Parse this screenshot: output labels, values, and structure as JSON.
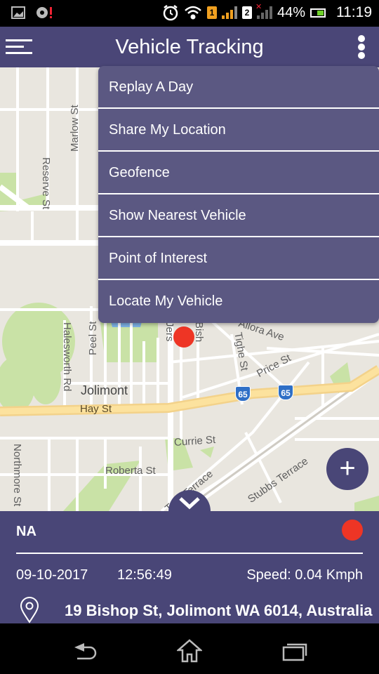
{
  "status_bar": {
    "battery_percent": "44%",
    "time": "11:19",
    "sim1_label": "1",
    "sim2_label": "2",
    "sim1_color": "#f0a020",
    "sim2_color": "#ffffff"
  },
  "app_bar": {
    "title": "Vehicle Tracking",
    "color": "#4a4677"
  },
  "menu": {
    "items": [
      {
        "label": "Replay A Day"
      },
      {
        "label": "Share My Location"
      },
      {
        "label": "Geofence"
      },
      {
        "label": "Show Nearest Vehicle"
      },
      {
        "label": "Point of Interest"
      },
      {
        "label": "Locate My Vehicle"
      }
    ]
  },
  "map": {
    "streets": {
      "reserve": "Reserve St",
      "marlow": "Marlow St",
      "halesworth": "Halesworth Rd",
      "peel": "Peel St",
      "jersey": "Jers",
      "bishop": "Bish",
      "allora": "Allora Ave",
      "tighe": "Tighe St",
      "price": "Price St",
      "hay": "Hay St",
      "currie": "Currie St",
      "roberta": "Roberta St",
      "troy": "Troy Terrace",
      "stubbs": "Stubbs Terrace",
      "northmore": "Northmore St"
    },
    "suburb": "Jolimont",
    "highway_shields": [
      "65",
      "65"
    ],
    "marker_color": "#ee3525"
  },
  "vehicle_info": {
    "name": "NA",
    "status_color": "#ee3525",
    "date": "09-10-2017",
    "time": "12:56:49",
    "speed": "Speed: 0.04 Kmph",
    "address": "19 Bishop St, Jolimont WA 6014, Australia"
  },
  "fab": {
    "label": "+"
  }
}
